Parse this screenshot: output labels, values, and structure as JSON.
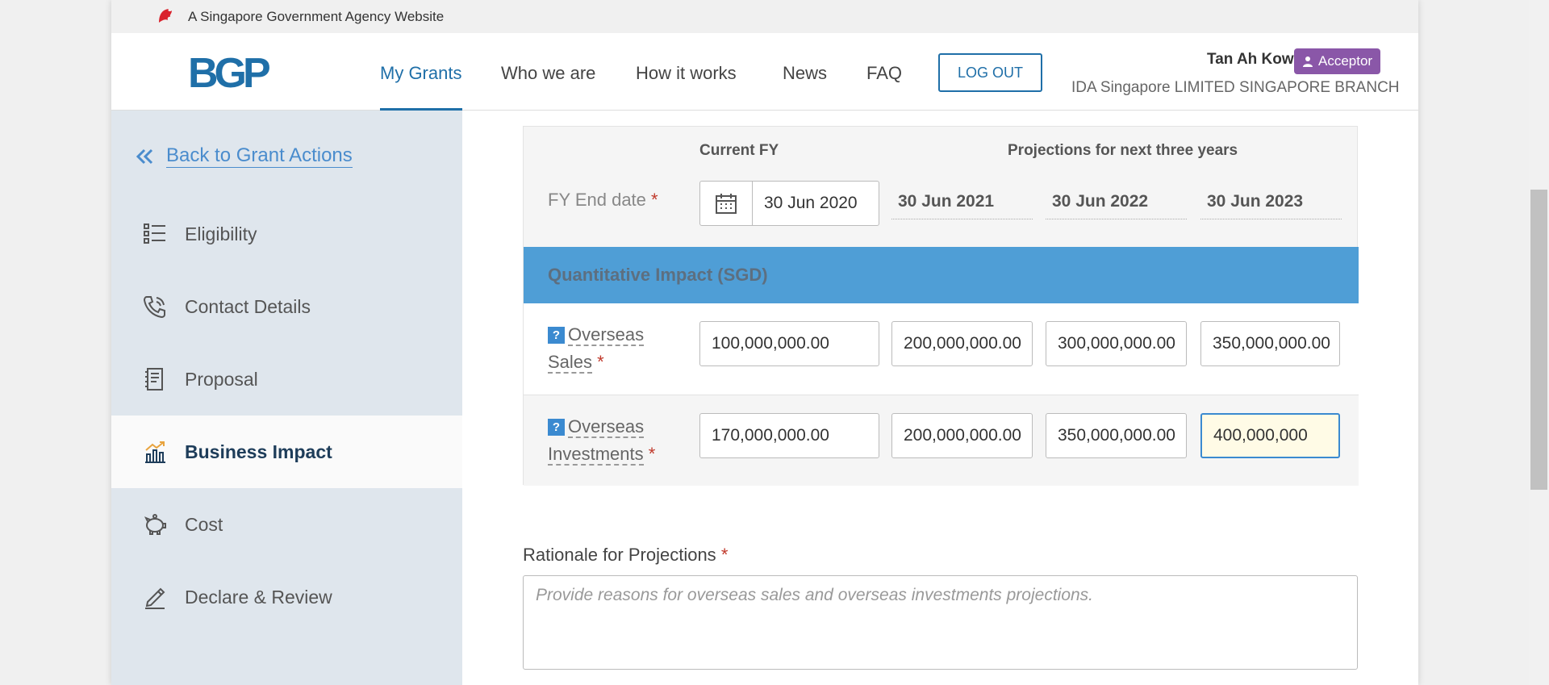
{
  "gov_bar": {
    "text": "A Singapore Government Agency Website"
  },
  "nav": {
    "brand": "BGP",
    "items": [
      {
        "label": "My Grants",
        "active": true
      },
      {
        "label": "Who we are"
      },
      {
        "label": "How it works"
      },
      {
        "label": "News"
      },
      {
        "label": "FAQ"
      }
    ],
    "logout_label": "LOG OUT",
    "user_name": "Tan Ah Kow",
    "role": "Acceptor",
    "org": "IDA Singapore LIMITED SINGAPORE BRANCH"
  },
  "sidebar": {
    "back_label": "Back to Grant Actions",
    "items": [
      {
        "label": "Eligibility",
        "icon": "list-icon"
      },
      {
        "label": "Contact Details",
        "icon": "phone-icon"
      },
      {
        "label": "Proposal",
        "icon": "document-icon"
      },
      {
        "label": "Business Impact",
        "icon": "chart-icon",
        "active": true
      },
      {
        "label": "Cost",
        "icon": "piggy-bank-icon"
      },
      {
        "label": "Declare & Review",
        "icon": "pen-icon"
      }
    ]
  },
  "table": {
    "current_fy_header": "Current FY",
    "projections_header": "Projections for next three years",
    "fy_end_label": "FY End date",
    "required_mark": "*",
    "current_fy_date": "30 Jun 2020",
    "projection_dates": [
      "30 Jun 2021",
      "30 Jun 2022",
      "30 Jun 2023"
    ],
    "section_title": "Quantitative Impact (SGD)",
    "help_mark": "?",
    "rows": [
      {
        "label_line1": "Overseas",
        "label_line2": "Sales",
        "values": [
          "100,000,000.00",
          "200,000,000.00",
          "300,000,000.00",
          "350,000,000.00"
        ]
      },
      {
        "label_line1": "Overseas",
        "label_line2": "Investments",
        "values": [
          "170,000,000.00",
          "200,000,000.00",
          "350,000,000.00",
          "400,000,000"
        ]
      }
    ]
  },
  "rationale": {
    "label": "Rationale for Projections",
    "placeholder": "Provide reasons for overseas sales and overseas investments projections."
  },
  "colors": {
    "accent": "#1f6fa8",
    "section_bar": "#4f9ed6",
    "role_badge": "#8a57a8",
    "sidebar_bg": "#dfe6ed"
  }
}
